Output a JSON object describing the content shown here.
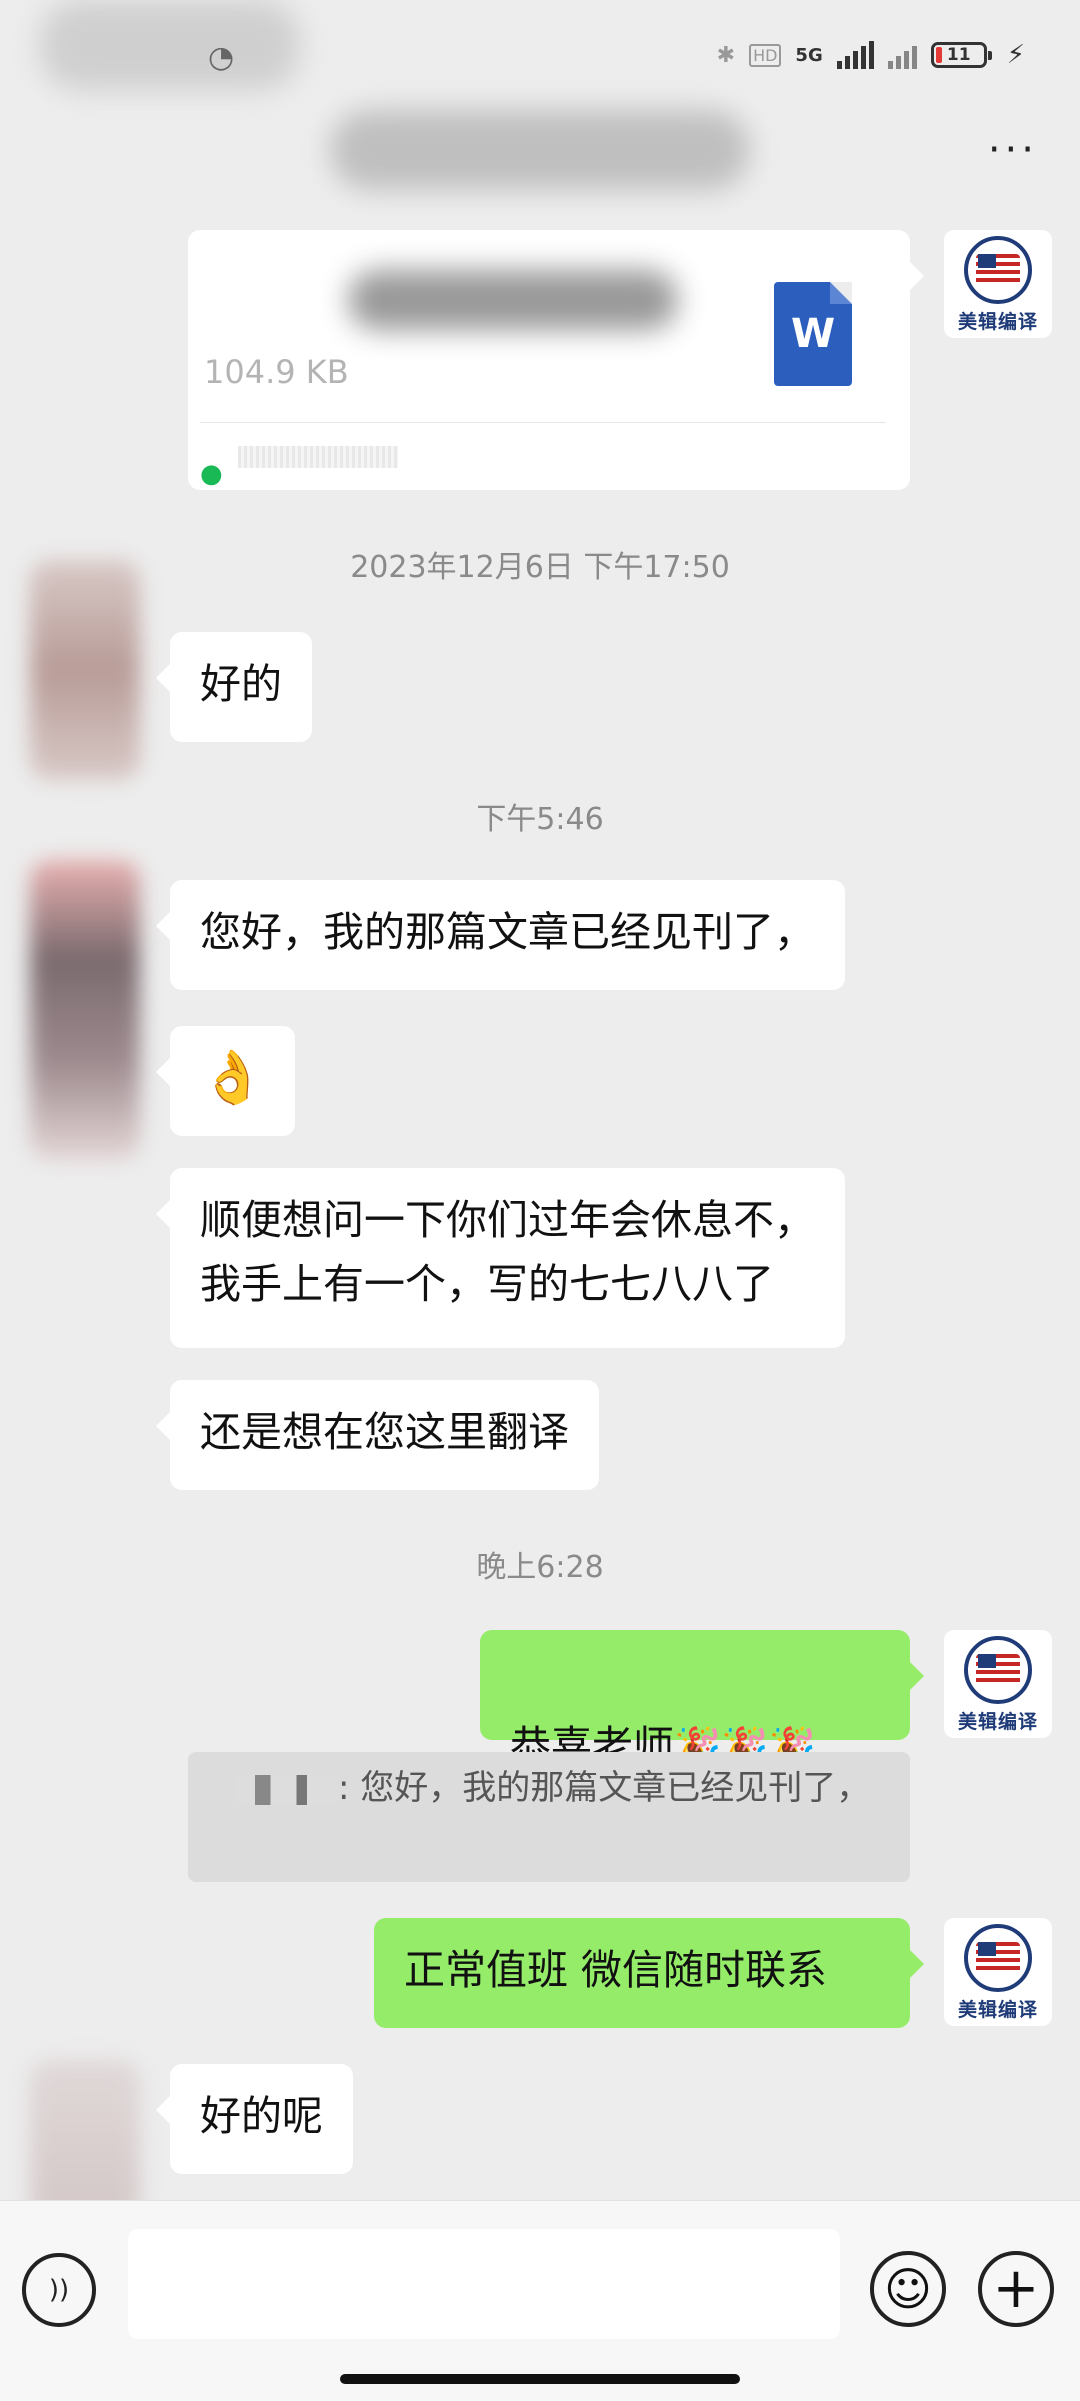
{
  "status_bar": {
    "network_label": "5G",
    "battery_level": "11"
  },
  "header": {
    "more_glyph": "···"
  },
  "file_message": {
    "file_size": "104.9 KB",
    "file_type_glyph": "W"
  },
  "messages": {
    "ts1": "2023年12月6日 下午17:50",
    "m1": "好的",
    "ts2": "下午5:46",
    "m2": "您好，我的那篇文章已经见刊了，",
    "m3": "👌",
    "m4": "顺便想问一下你们过年会休息不，\n我手上有一个，写的七七八八了",
    "m5": "还是想在您这里翻译",
    "ts3": "晚上6:28",
    "m6_text": "恭喜老师",
    "m6_emoji": "🎉🎉🎉",
    "quote_text": ": 您好，我的那篇文章已经见刊了，",
    "m7": "正常值班 微信随时联系",
    "m8": "好的呢"
  },
  "self_avatar": {
    "label": "美辑编译"
  },
  "input_bar": {
    "emoji_glyph": "☺",
    "plus_glyph": "+",
    "voice_glyph": "))"
  }
}
